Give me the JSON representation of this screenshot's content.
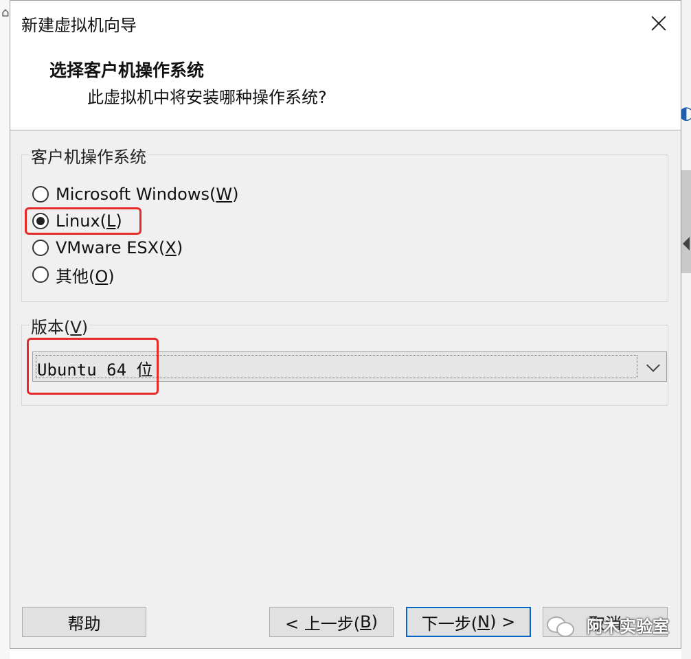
{
  "window": {
    "title": "新建虚拟机向导"
  },
  "header": {
    "title": "选择客户机操作系统",
    "subtitle": "此虚拟机中将安装哪种操作系统?"
  },
  "os_group": {
    "label": "客户机操作系统",
    "options": [
      {
        "text": "Microsoft Windows(",
        "key": "W",
        "end": ")",
        "checked": false
      },
      {
        "text": "Linux(",
        "key": "L",
        "end": ")",
        "checked": true
      },
      {
        "text": "VMware ESX(",
        "key": "X",
        "end": ")",
        "checked": false
      },
      {
        "text": "其他(",
        "key": "O",
        "end": ")",
        "checked": false
      }
    ]
  },
  "version_group": {
    "label_text": "版本(",
    "label_key": "V",
    "label_end": ")",
    "selected": "Ubuntu 64 位"
  },
  "buttons": {
    "help": "帮助",
    "back_prefix": "< 上一步(",
    "back_key": "B",
    "back_suffix": ")",
    "next_prefix": "下一步(",
    "next_key": "N",
    "next_suffix": ") >",
    "cancel": "取消"
  },
  "watermark": {
    "text": "阿木实验室"
  },
  "colors": {
    "highlight_box": "#e52a2a",
    "default_button_border": "#0a64c8"
  }
}
